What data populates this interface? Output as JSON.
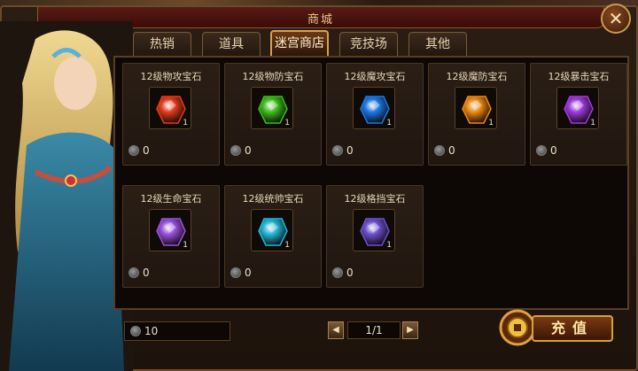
{
  "window": {
    "title": "商城"
  },
  "tabs": [
    {
      "label": "热销",
      "active": false
    },
    {
      "label": "道具",
      "active": false
    },
    {
      "label": "迷宫商店",
      "active": true
    },
    {
      "label": "竞技场",
      "active": false
    },
    {
      "label": "其他",
      "active": false
    }
  ],
  "items": [
    {
      "name": "12级物攻宝石",
      "qty": "1",
      "price": "0",
      "color": "#e83a1a"
    },
    {
      "name": "12级物防宝石",
      "qty": "1",
      "price": "0",
      "color": "#3ac01a"
    },
    {
      "name": "12级魔攻宝石",
      "qty": "1",
      "price": "0",
      "color": "#1a7ae8"
    },
    {
      "name": "12级魔防宝石",
      "qty": "1",
      "price": "0",
      "color": "#f08a10"
    },
    {
      "name": "12级暴击宝石",
      "qty": "1",
      "price": "0",
      "color": "#a03ae0"
    },
    {
      "name": "12级生命宝石",
      "qty": "1",
      "price": "0",
      "color": "#9a50e0"
    },
    {
      "name": "12级统帅宝石",
      "qty": "1",
      "price": "0",
      "color": "#20b8d8"
    },
    {
      "name": "12级格挡宝石",
      "qty": "1",
      "price": "0",
      "color": "#6a50d0"
    }
  ],
  "footer": {
    "balance": "10",
    "page": "1/1",
    "prev_icon": "◀",
    "next_icon": "▶",
    "recharge_label": "充值"
  },
  "icons": {
    "close": "✕"
  }
}
